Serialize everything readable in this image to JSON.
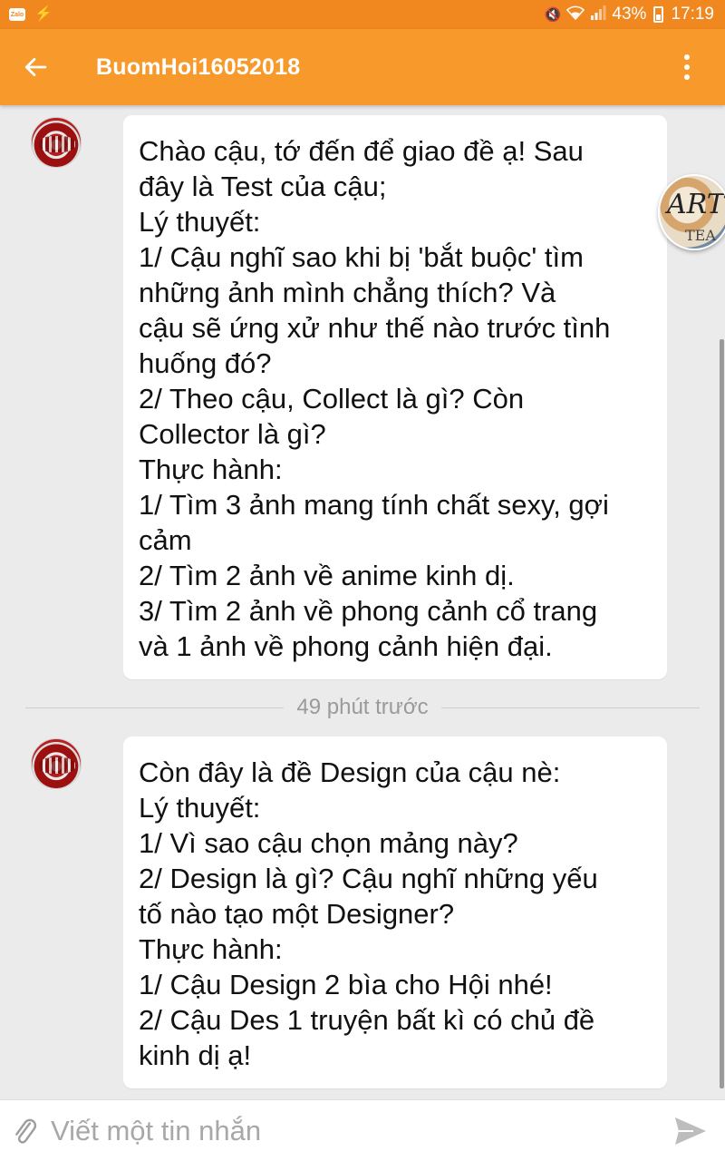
{
  "status_bar": {
    "left_icons": [
      "zalo-icon",
      "bolt-icon"
    ],
    "right_icons": [
      "mute-icon",
      "wifi-icon",
      "signal-icon",
      "battery-icon"
    ],
    "battery": "43%",
    "time": "17:19",
    "color": "#f0871f"
  },
  "app_bar": {
    "title": "BuomHoi16052018",
    "back_icon": "arrow-left-icon",
    "menu_icon": "more-vertical-icon",
    "color": "#f79a2b"
  },
  "messages": [
    {
      "lines": [
        "Chào cậu, tớ đến để giao đề ạ! Sau",
        "đây là Test của cậu;",
        "Lý thuyết:",
        "1/ Cậu nghĩ sao khi bị 'bắt buộc' tìm",
        "những ảnh mình chẳng thích? Và",
        "cậu sẽ ứng xử như thế nào trước tình",
        "huống đó?",
        "2/ Theo cậu, Collect là gì? Còn",
        "Collector là gì?",
        "Thực hành:",
        "1/ Tìm 3 ảnh mang tính chất sexy, gợi",
        "cảm",
        "2/ Tìm 2 ảnh về anime kinh dị.",
        "3/ Tìm 2 ảnh về phong cảnh cổ trang",
        "và 1 ảnh về phong cảnh hiện đại."
      ]
    },
    {
      "lines": [
        "Còn đây là đề Design của cậu nè:",
        "Lý thuyết:",
        "1/ Vì sao cậu chọn mảng này?",
        "2/ Design là gì? Cậu nghĩ những yếu",
        "tố nào tạo một Designer?",
        "Thực hành:",
        "1/ Cậu Design 2 bìa cho Hội nhé!",
        "2/ Cậu Des 1 truyện bất kì có chủ đề",
        "kinh dị ạ!"
      ]
    }
  ],
  "divider": {
    "time": "49 phút trước"
  },
  "floating_badge": {
    "text_top": "ART",
    "text_bottom": "TEA"
  },
  "input": {
    "placeholder": "Viết một tin nhắn",
    "attach_icon": "paperclip-icon",
    "send_icon": "send-icon"
  }
}
